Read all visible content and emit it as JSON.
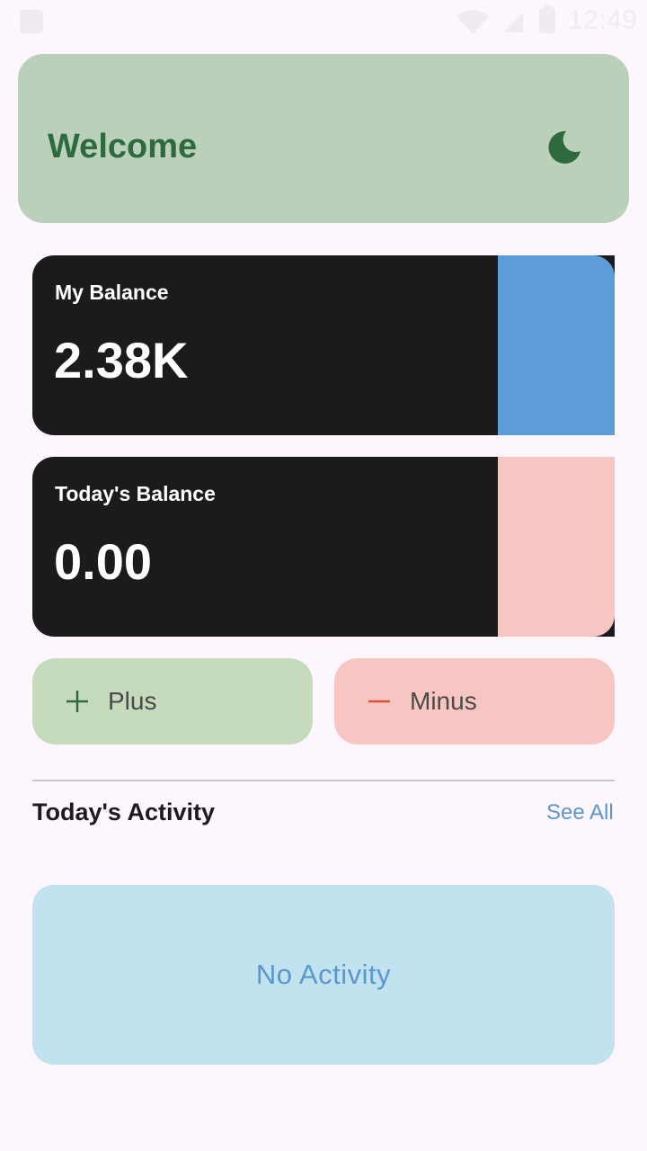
{
  "status_bar": {
    "time": "12:49"
  },
  "header": {
    "title": "Welcome",
    "theme_toggle_icon": "moon-icon"
  },
  "cards": [
    {
      "label": "My Balance",
      "value": "2.38K",
      "accent_color": "#5c9cd8"
    },
    {
      "label": "Today's Balance",
      "value": "0.00",
      "accent_color": "#f8c6c2"
    }
  ],
  "actions": {
    "plus_label": "Plus",
    "minus_label": "Minus",
    "plus_icon": "plus-icon",
    "minus_icon": "minus-icon"
  },
  "activity": {
    "title": "Today's Activity",
    "see_all": "See All",
    "empty_text": "No Activity"
  },
  "colors": {
    "background": "#fdf6fd",
    "welcome_bg": "#bbd0bb",
    "brand_green": "#2d6b3f",
    "card_dark": "#1c1b1c",
    "plus_bg": "#c5dbbc",
    "minus_bg": "#f8c6c2",
    "minus_icon": "#d9533f",
    "link_blue": "#5a97d0",
    "activity_bg": "#c1e2ee"
  }
}
